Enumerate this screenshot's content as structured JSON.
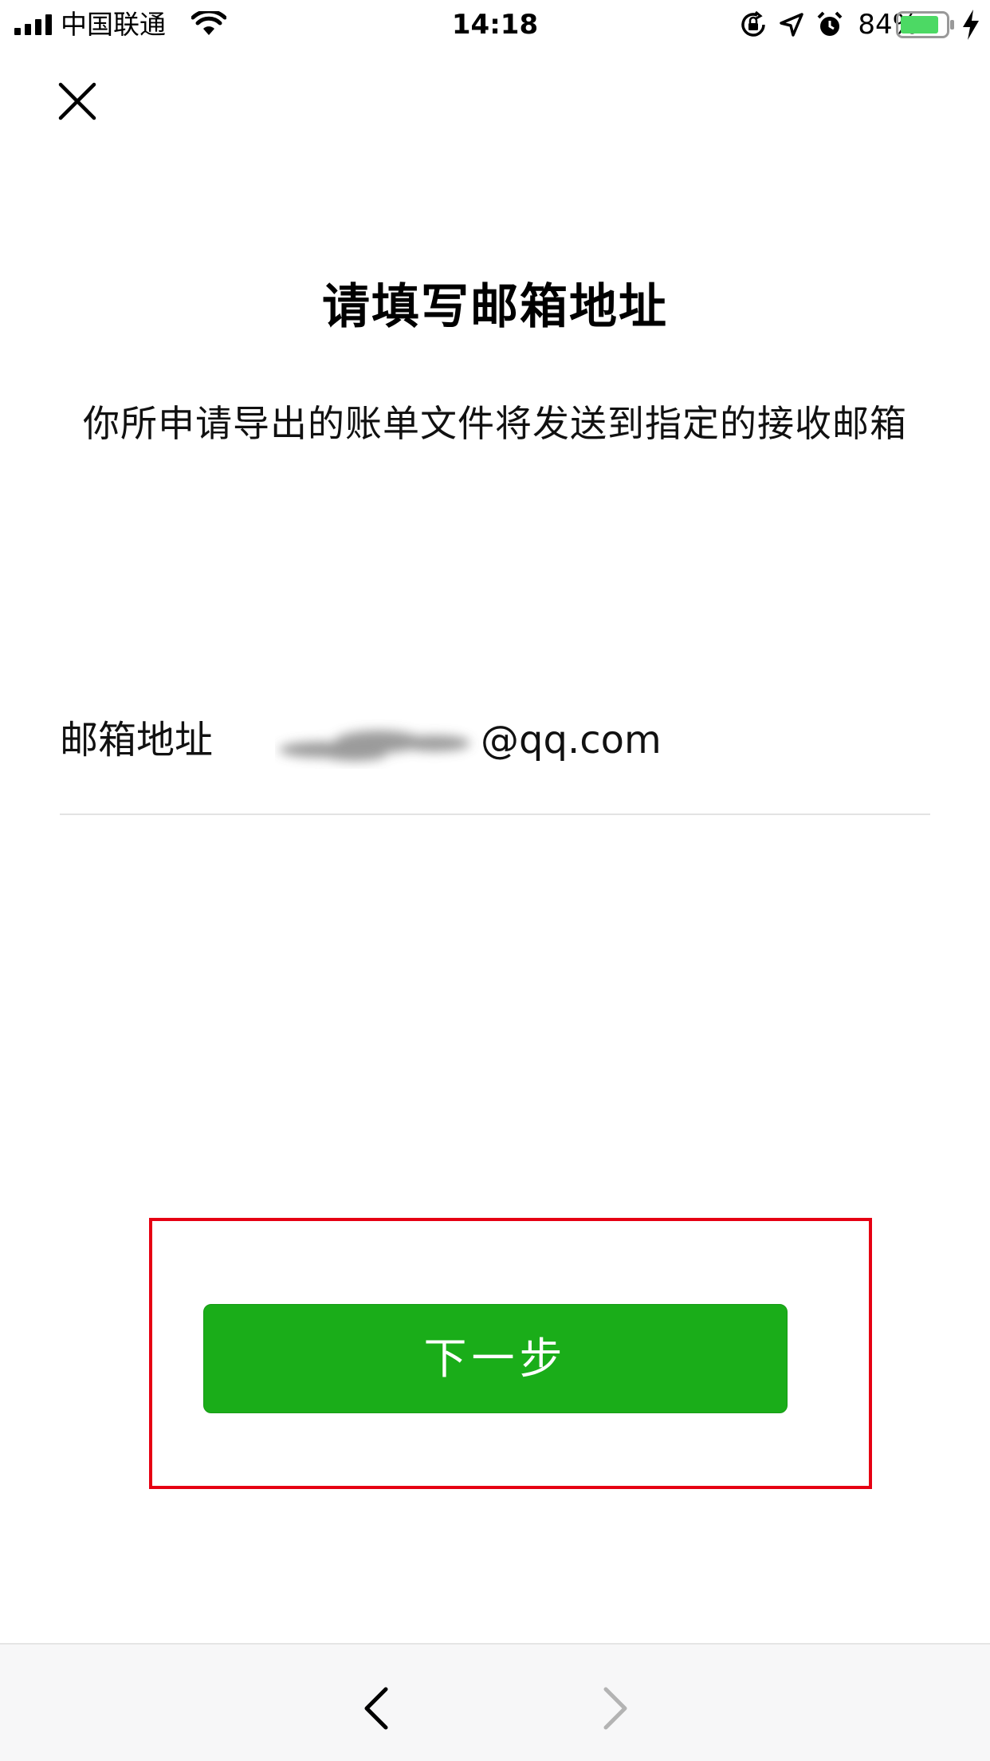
{
  "status_bar": {
    "carrier": "中国联通",
    "time": "14:18",
    "battery_percent": "84%",
    "battery_level": 0.84
  },
  "page": {
    "title": "请填写邮箱地址",
    "description": "你所申请导出的账单文件将发送到指定的接收邮箱"
  },
  "email": {
    "label": "邮箱地址",
    "value_suffix": "@qq.com"
  },
  "actions": {
    "next_label": "下一步"
  },
  "colors": {
    "primary_green": "#1aad19",
    "highlight_red": "#e60012",
    "battery_green": "#4cd964"
  },
  "icons": {
    "close": "close-icon",
    "back": "chevron-left-icon",
    "forward": "chevron-right-icon"
  }
}
